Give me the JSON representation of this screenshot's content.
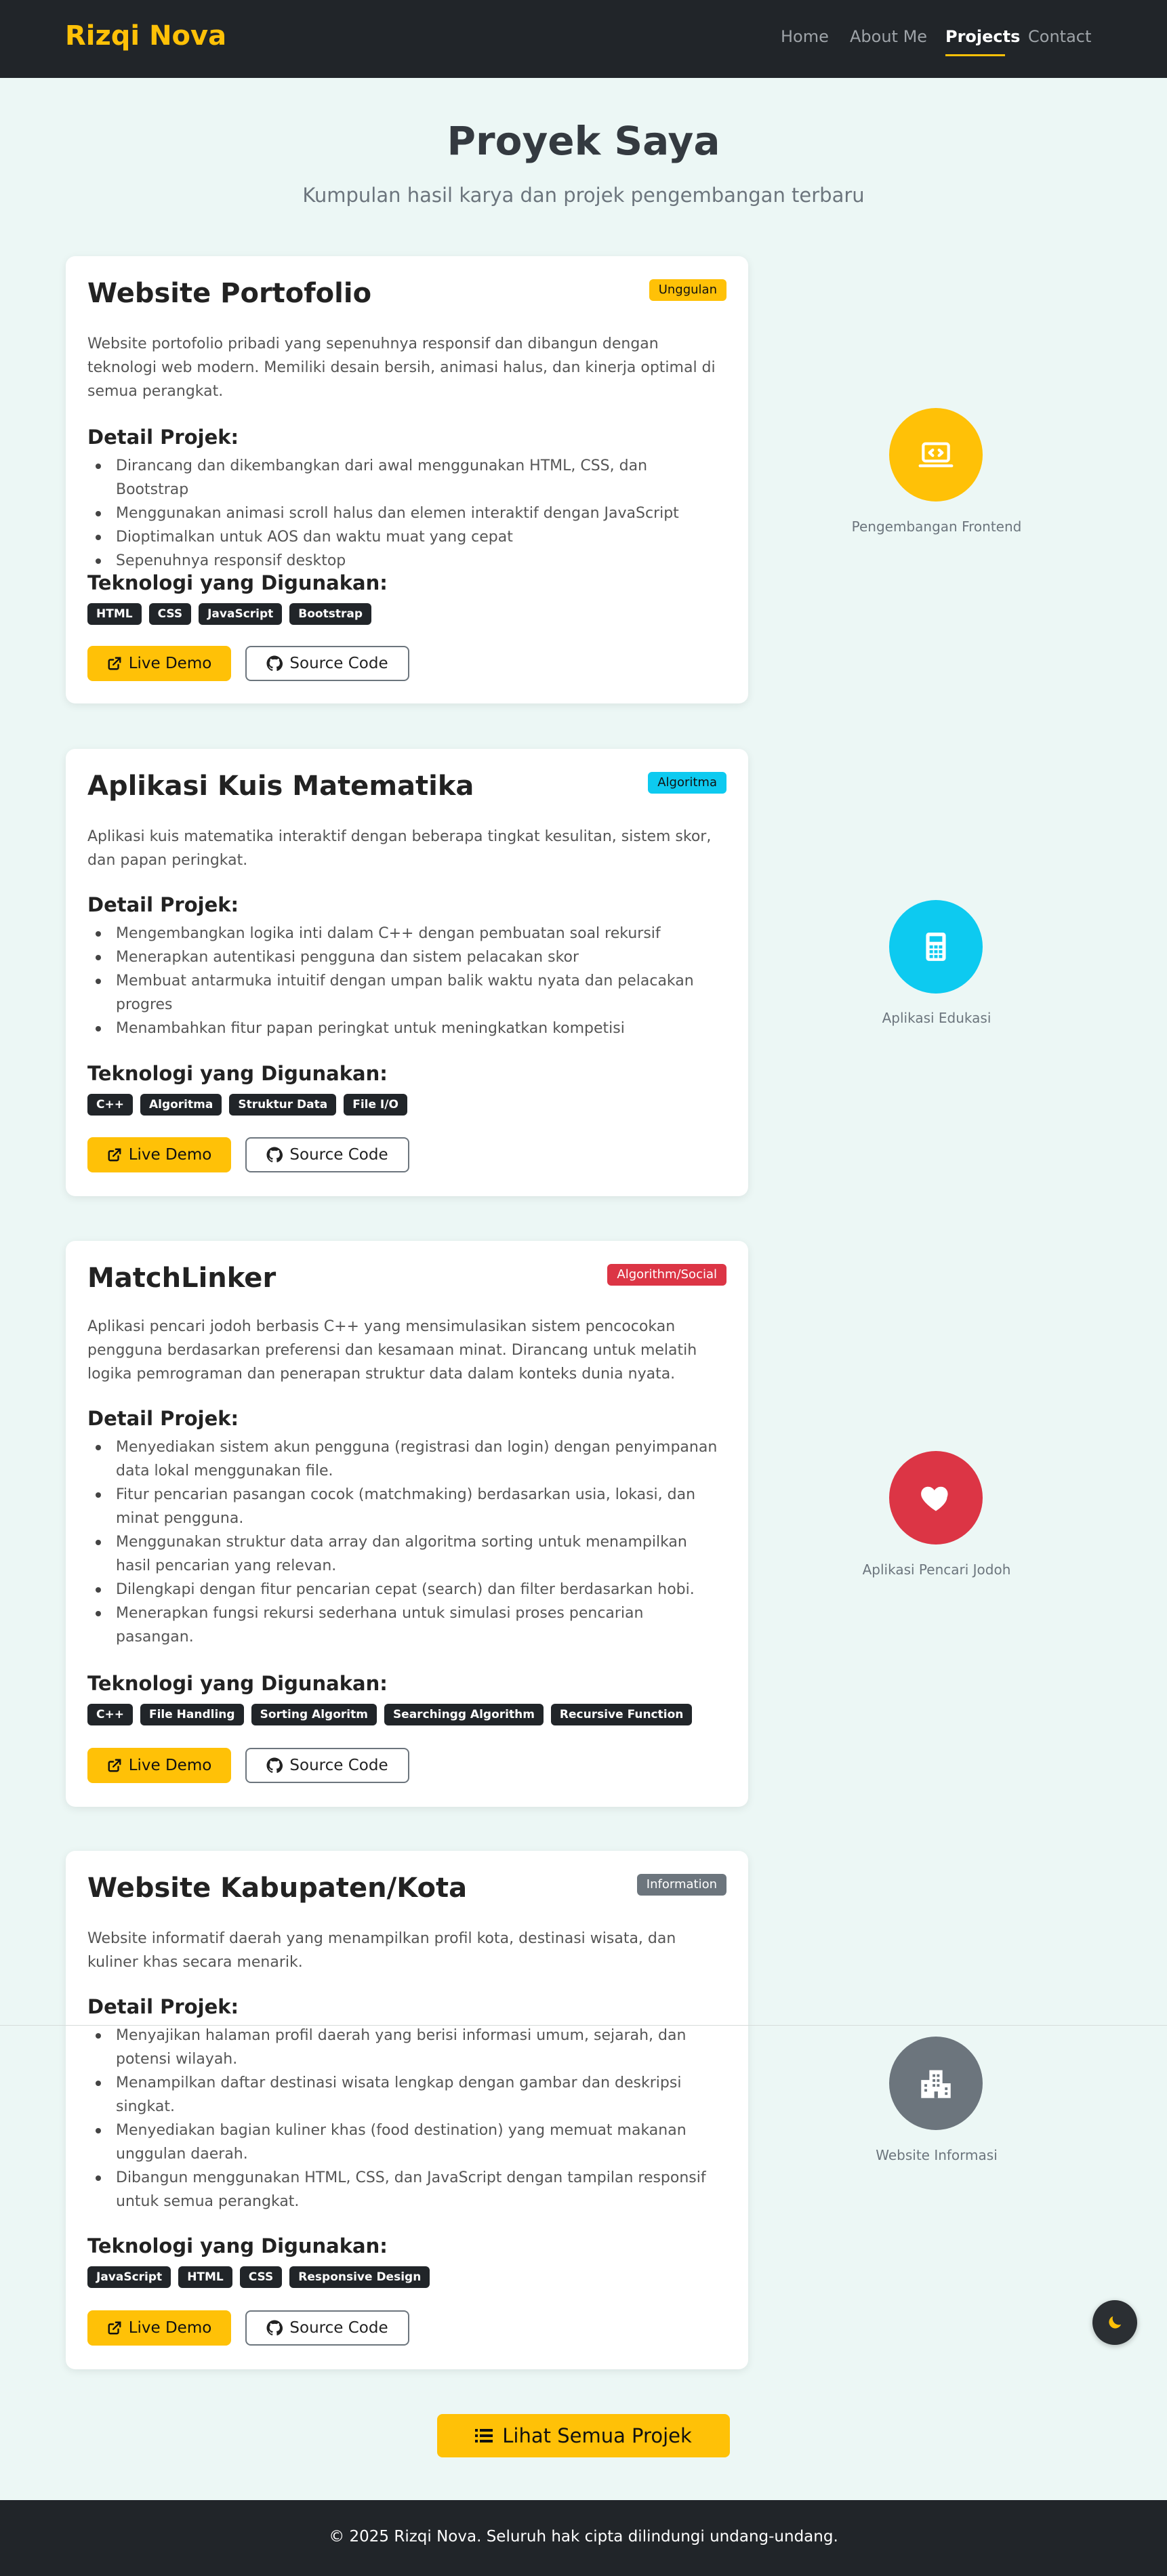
{
  "nav": {
    "brand": "Rizqi Nova",
    "links": [
      "Home",
      "About Me",
      "Projects",
      "Contact"
    ],
    "active_link": "Projects"
  },
  "header": {
    "title": "Proyek Saya",
    "subtitle": "Kumpulan hasil karya dan projek pengembangan terbaru"
  },
  "labels": {
    "detail_heading": "Detail Projek:",
    "tech_heading": "Teknologi yang Digunakan:",
    "live_demo": "Live Demo",
    "source_code": "Source Code"
  },
  "projects": [
    {
      "title": "Website Portofolio",
      "badge": "Unggulan",
      "badge_color": "#ffc107",
      "description": "Website portofolio pribadi yang sepenuhnya responsif dan dibangun dengan teknologi web modern. Memiliki desain bersih, animasi halus, dan kinerja optimal di semua perangkat.",
      "details": [
        "Dirancang dan dikembangkan dari awal menggunakan HTML, CSS, dan Bootstrap",
        "Menggunakan animasi scroll halus dan elemen interaktif dengan JavaScript",
        "Dioptimalkan untuk AOS dan waktu muat yang cepat",
        "Sepenuhnya responsif desktop"
      ],
      "tech": [
        "HTML",
        "CSS",
        "JavaScript",
        "Bootstrap"
      ],
      "icon": "laptop-code-icon",
      "icon_color": "#ffc107",
      "category": "Pengembangan Frontend"
    },
    {
      "title": "Aplikasi Kuis Matematika",
      "badge": "Algoritma",
      "badge_color": "#0dcaf0",
      "description": "Aplikasi kuis matematika interaktif dengan beberapa tingkat kesulitan, sistem skor, dan papan peringkat.",
      "details": [
        "Mengembangkan logika inti dalam C++ dengan pembuatan soal rekursif",
        "Menerapkan autentikasi pengguna dan sistem pelacakan skor",
        "Membuat antarmuka intuitif dengan umpan balik waktu nyata dan pelacakan progres",
        "Menambahkan fitur papan peringkat untuk meningkatkan kompetisi"
      ],
      "tech": [
        "C++",
        "Algoritma",
        "Struktur Data",
        "File I/O"
      ],
      "icon": "calculator-icon",
      "icon_color": "#0dcaf0",
      "category": "Aplikasi Edukasi"
    },
    {
      "title": "MatchLinker",
      "badge": "Algorithm/Social",
      "badge_color": "#dc3545",
      "description": "Aplikasi pencari jodoh berbasis C++ yang mensimulasikan sistem pencocokan pengguna berdasarkan preferensi dan kesamaan minat. Dirancang untuk melatih logika pemrograman dan penerapan struktur data dalam konteks dunia nyata.",
      "details": [
        "Menyediakan sistem akun pengguna (registrasi dan login) dengan penyimpanan data lokal menggunakan file.",
        "Fitur pencarian pasangan cocok (matchmaking) berdasarkan usia, lokasi, dan minat pengguna.",
        "Menggunakan struktur data array dan algoritma sorting untuk menampilkan hasil pencarian yang relevan.",
        "Dilengkapi dengan fitur pencarian cepat (search) dan filter berdasarkan hobi.",
        "Menerapkan fungsi rekursi sederhana untuk simulasi proses pencarian pasangan."
      ],
      "tech": [
        "C++",
        "File Handling",
        "Sorting Algoritm",
        "Searchingg Algorithm",
        "Recursive Function"
      ],
      "icon": "heart-icon",
      "icon_color": "#dc3545",
      "category": "Aplikasi Pencari Jodoh"
    },
    {
      "title": "Website Kabupaten/Kota",
      "badge": "Information",
      "badge_color": "#6c757d",
      "description": "Website informatif daerah yang menampilkan profil kota, destinasi wisata, dan kuliner khas secara menarik.",
      "details": [
        "Menyajikan halaman profil daerah yang berisi informasi umum, sejarah, dan potensi wilayah.",
        "Menampilkan daftar destinasi wisata lengkap dengan gambar dan deskripsi singkat.",
        "Menyediakan bagian kuliner khas (food destination) yang memuat makanan unggulan daerah.",
        "Dibangun menggunakan HTML, CSS, dan JavaScript dengan tampilan responsif untuk semua perangkat."
      ],
      "tech": [
        "JavaScript",
        "HTML",
        "CSS",
        "Responsive Design"
      ],
      "icon": "city-icon",
      "icon_color": "#6c757d",
      "category": "Website Informasi"
    }
  ],
  "all_projects_button": "Lihat Semua Projek",
  "theme_toggle_icon": "moon-icon",
  "footer": {
    "copyright": "© 2025 Rizqi Nova. Seluruh hak cipta dilindungi undang-undang."
  }
}
